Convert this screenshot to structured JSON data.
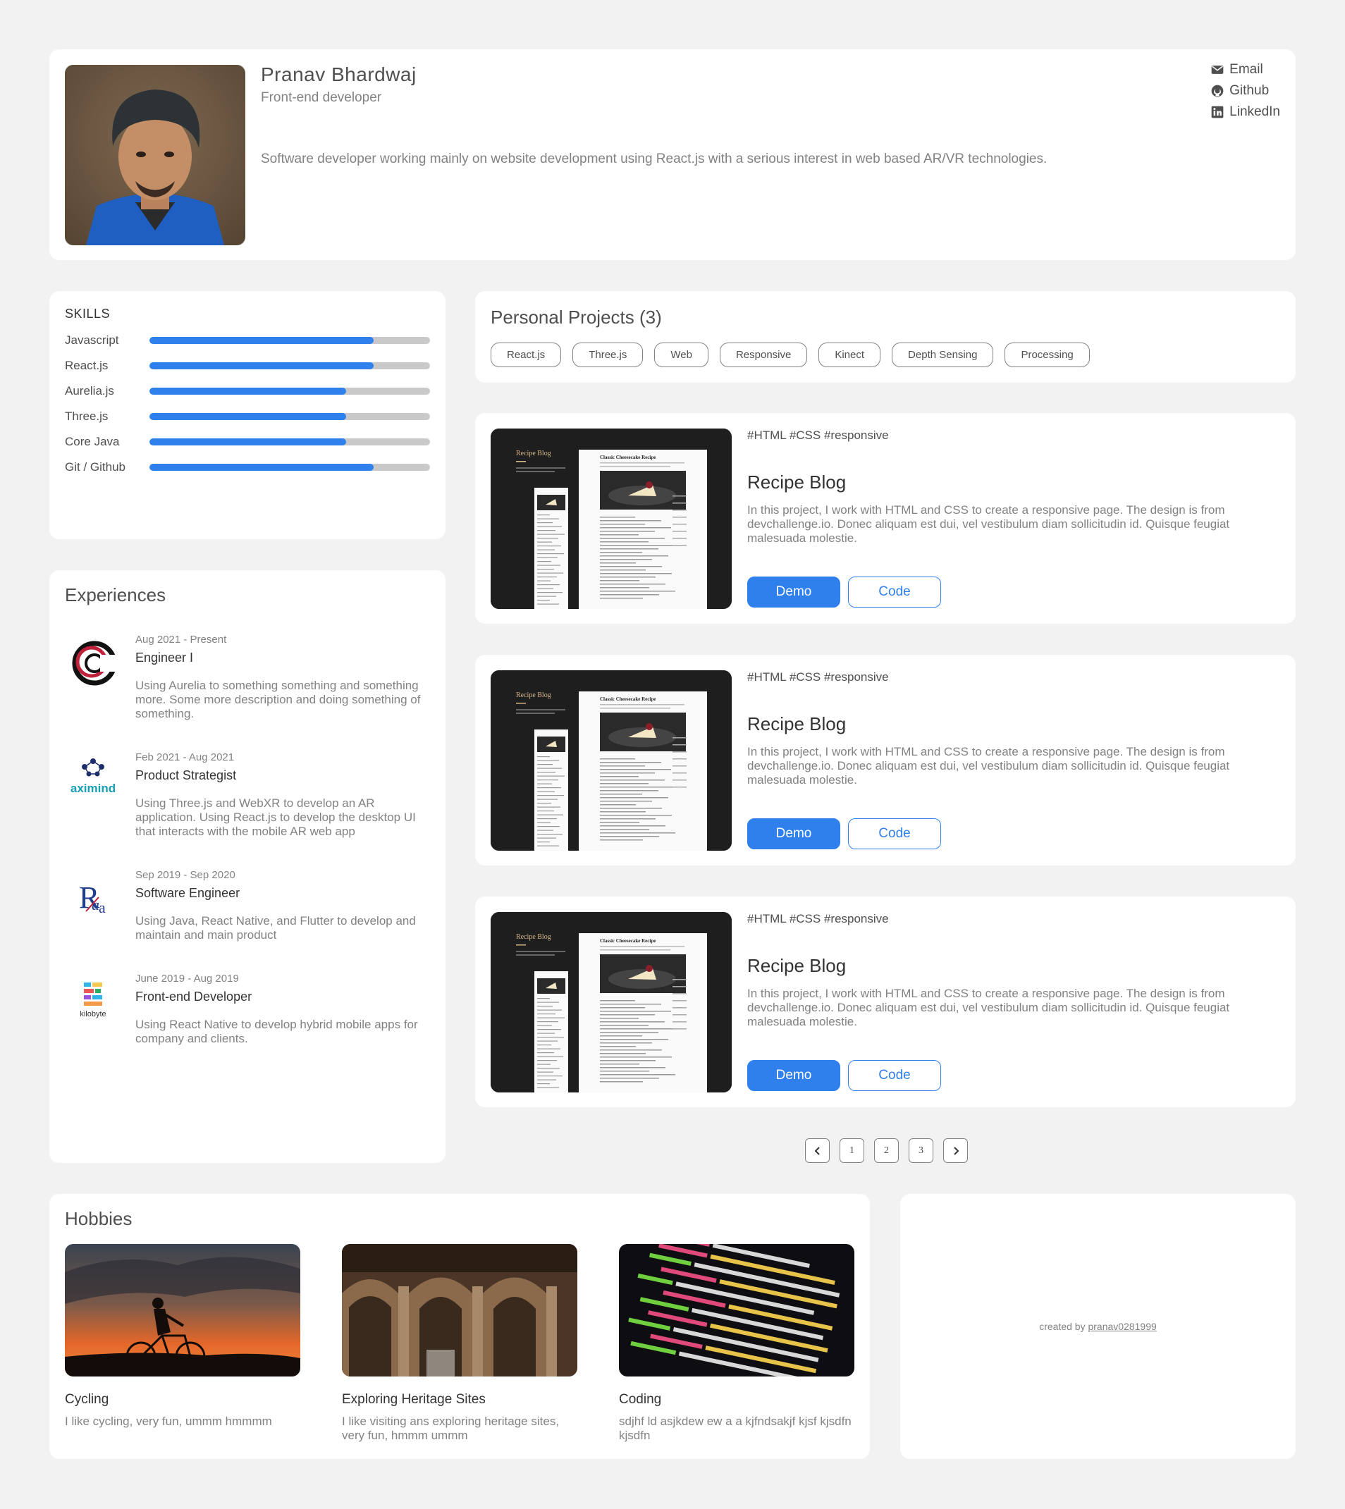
{
  "profile": {
    "name": "Pranav Bhardwaj",
    "role": "Front-end developer",
    "bio": "Software developer working mainly on website development using React.js with a serious interest in web based AR/VR technologies.",
    "contacts": [
      {
        "label": "Email",
        "icon": "mail-icon"
      },
      {
        "label": "Github",
        "icon": "github-icon"
      },
      {
        "label": "LinkedIn",
        "icon": "linkedin-icon"
      }
    ]
  },
  "skills": {
    "title": "SKILLS",
    "items": [
      {
        "name": "Javascript",
        "level": 0.8
      },
      {
        "name": "React.js",
        "level": 0.8
      },
      {
        "name": "Aurelia.js",
        "level": 0.7
      },
      {
        "name": "Three.js",
        "level": 0.7
      },
      {
        "name": "Core Java",
        "level": 0.7
      },
      {
        "name": "Git / Github",
        "level": 0.8
      }
    ]
  },
  "experiences": {
    "title": "Experiences",
    "items": [
      {
        "date": "Aug 2021 - Present",
        "title": "Engineer I",
        "desc": "Using Aurelia to something something and something more. Some more description and doing something of something."
      },
      {
        "date": "Feb 2021 - Aug 2021",
        "title": "Product Strategist",
        "desc": "Using Three.js and WebXR to develop an AR application. Using React.js to develop the desktop UI that interacts with the mobile AR web app",
        "logo_text": "aximind"
      },
      {
        "date": "Sep 2019 - Sep 2020",
        "title": "Software Engineer",
        "desc": "Using Java, React Native, and Flutter to develop and maintain and main product"
      },
      {
        "date": "June 2019 - Aug 2019",
        "title": "Front-end Developer",
        "desc": "Using React Native to develop hybrid mobile apps for company and clients.",
        "logo_text": "kilobyte"
      }
    ]
  },
  "projects": {
    "title": "Personal Projects (3)",
    "tags": [
      "React.js",
      "Three.js",
      "Web",
      "Responsive",
      "Kinect",
      "Depth Sensing",
      "Processing"
    ],
    "items": [
      {
        "hashtags": "#HTML #CSS #responsive",
        "title": "Recipe Blog",
        "desc": "In this project, I work with HTML and CSS to create a responsive page. The design is from devchallenge.io. Donec aliquam est dui, vel vestibulum diam sollicitudin id. Quisque feugiat malesuada molestie.",
        "demo": "Demo",
        "code": "Code"
      },
      {
        "hashtags": "#HTML #CSS #responsive",
        "title": "Recipe Blog",
        "desc": "In this project, I work with HTML and CSS to create a responsive page. The design is from devchallenge.io. Donec aliquam est dui, vel vestibulum diam sollicitudin id. Quisque feugiat malesuada molestie.",
        "demo": "Demo",
        "code": "Code"
      },
      {
        "hashtags": "#HTML #CSS #responsive",
        "title": "Recipe Blog",
        "desc": "In this project, I work with HTML and CSS to create a responsive page. The design is from devchallenge.io. Donec aliquam est dui, vel vestibulum diam sollicitudin id. Quisque feugiat malesuada molestie.",
        "demo": "Demo",
        "code": "Code"
      }
    ],
    "thumb": {
      "blog_name": "Recipe Blog",
      "recipe_title": "Classic Cheesecake Recipe"
    },
    "pagination": {
      "prev_icon": "chevron-left-icon",
      "pages": [
        "1",
        "2",
        "3"
      ],
      "next_icon": "chevron-right-icon"
    }
  },
  "hobbies": {
    "title": "Hobbies",
    "items": [
      {
        "title": "Cycling",
        "desc": "I like cycling, very fun, ummm hmmmm"
      },
      {
        "title": "Exploring Heritage Sites",
        "desc": "I like visiting ans exploring heritage sites, very fun, hmmm ummm"
      },
      {
        "title": "Coding",
        "desc": "sdjhf ld asjkdew ew a a kjfndsakjf kjsf kjsdfn kjsdfn"
      }
    ]
  },
  "footer": {
    "prefix": "created by",
    "handle": "pranav0281999"
  },
  "colors": {
    "accent": "#2f80ed",
    "background": "#f2f2f2",
    "track": "#c9c9c9"
  }
}
